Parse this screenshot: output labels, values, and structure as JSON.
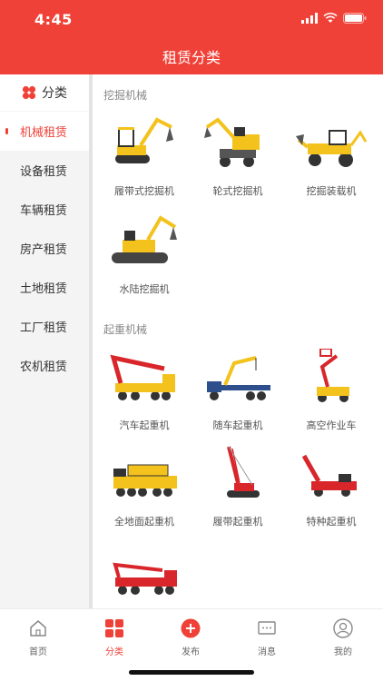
{
  "status": {
    "time": "4:45"
  },
  "header": {
    "title": "租赁分类"
  },
  "sidebar": {
    "head_label": "分类",
    "items": [
      {
        "label": "机械租赁"
      },
      {
        "label": "设备租赁"
      },
      {
        "label": "车辆租赁"
      },
      {
        "label": "房产租赁"
      },
      {
        "label": "土地租赁"
      },
      {
        "label": "工厂租赁"
      },
      {
        "label": "农机租赁"
      }
    ]
  },
  "sections": [
    {
      "title": "挖掘机械",
      "items": [
        {
          "label": "履带式挖掘机"
        },
        {
          "label": "轮式挖掘机"
        },
        {
          "label": "挖掘装载机"
        },
        {
          "label": "水陆挖掘机"
        }
      ]
    },
    {
      "title": "起重机械",
      "items": [
        {
          "label": "汽车起重机"
        },
        {
          "label": "随车起重机"
        },
        {
          "label": "高空作业车"
        },
        {
          "label": "全地面起重机"
        },
        {
          "label": "履带起重机"
        },
        {
          "label": "特种起重机"
        },
        {
          "label": ""
        }
      ]
    }
  ],
  "tabbar": {
    "items": [
      {
        "label": "首页",
        "icon": "home-icon"
      },
      {
        "label": "分类",
        "icon": "category-icon"
      },
      {
        "label": "发布",
        "icon": "plus-circle-icon"
      },
      {
        "label": "消息",
        "icon": "message-icon"
      },
      {
        "label": "我的",
        "icon": "profile-icon"
      }
    ]
  },
  "colors": {
    "brand": "#ef4137",
    "sidebar_bg": "#f4f4f4",
    "machine_yellow": "#f3c21d",
    "machine_red": "#d8262b"
  }
}
